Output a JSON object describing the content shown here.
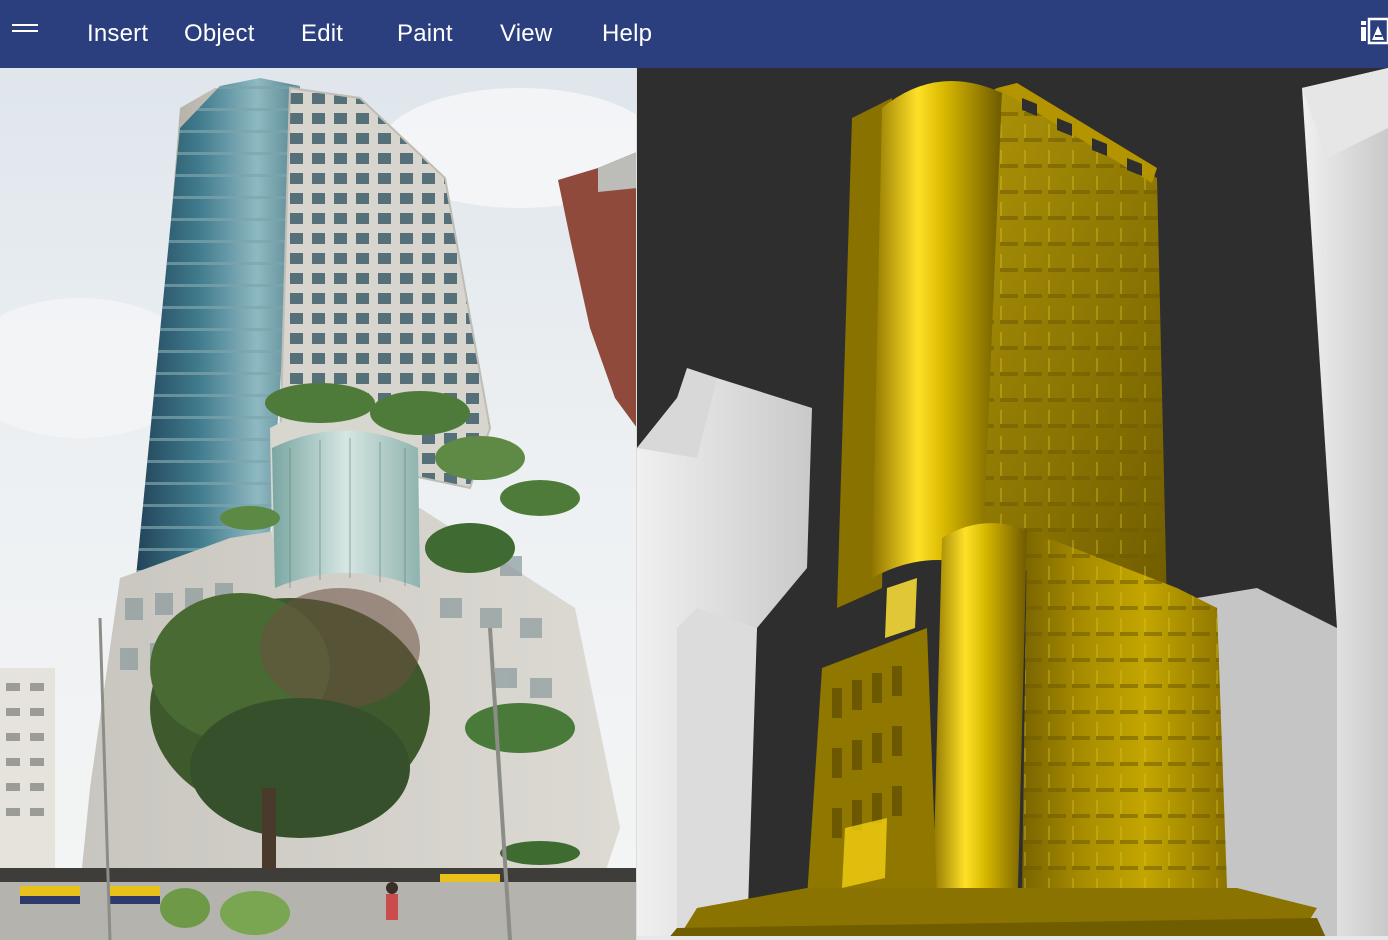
{
  "menubar": {
    "items": [
      {
        "id": "insert",
        "label": "Insert"
      },
      {
        "id": "object",
        "label": "Object"
      },
      {
        "id": "edit",
        "label": "Edit"
      },
      {
        "id": "paint",
        "label": "Paint"
      },
      {
        "id": "view",
        "label": "View"
      },
      {
        "id": "help",
        "label": "Help"
      }
    ],
    "menu_icon": "hamburger-menu-icon",
    "right_icon": "image-panel-icon",
    "color": "#2b3f7e"
  },
  "panels": {
    "left": {
      "content": "photo of high-rise building"
    },
    "right": {
      "content": "3D gold model of high-rise building",
      "background": "#2e2e2e",
      "model_color": "#c9a800"
    }
  }
}
